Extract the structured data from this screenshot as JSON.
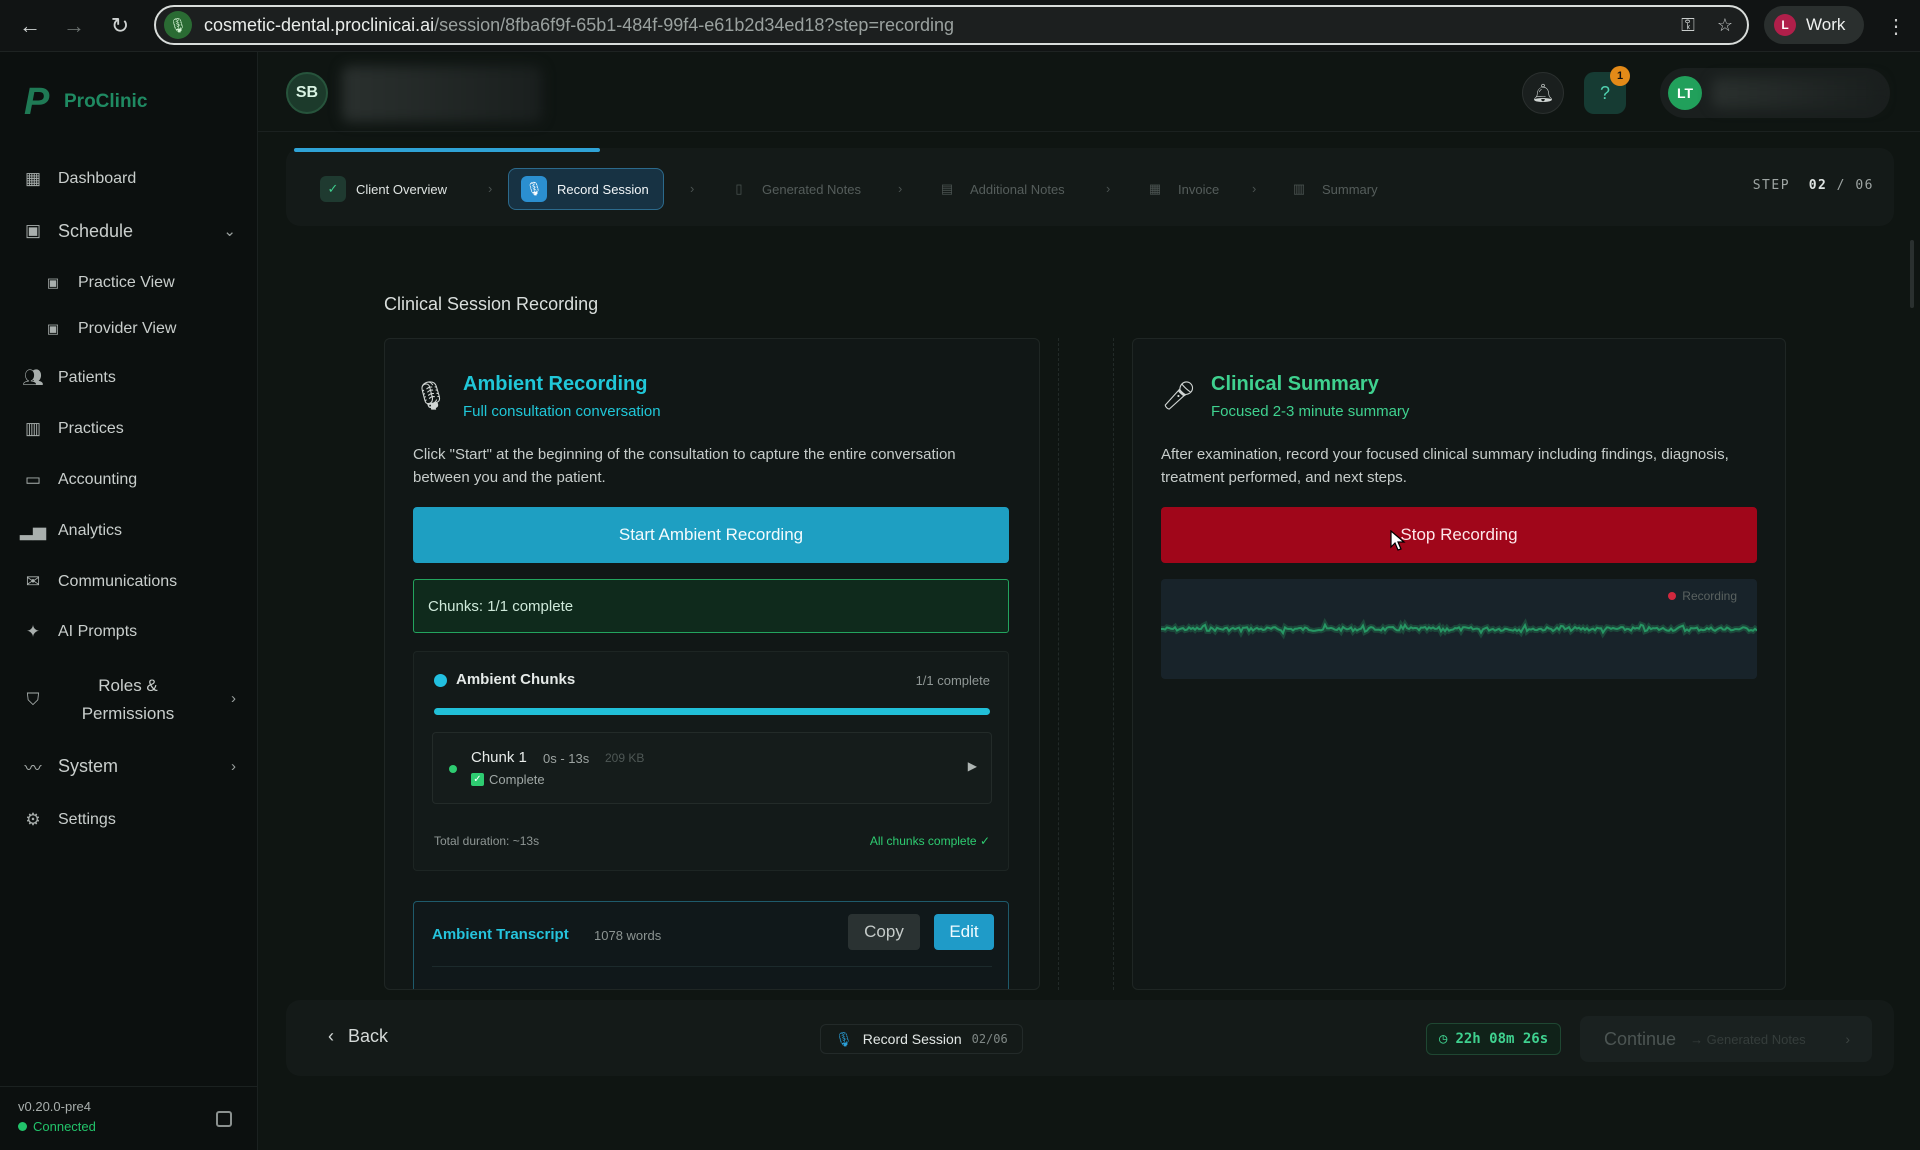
{
  "browser": {
    "url_host": "cosmetic-dental.proclinicai.ai",
    "url_path": "/session/8fba6f9f-65b1-484f-99f4-e61b2d34ed18?step=recording",
    "profile_initial": "L",
    "profile_label": "Work"
  },
  "brand": {
    "name": "ProClinic"
  },
  "sidebar": {
    "items": [
      {
        "label": "Dashboard",
        "icon": "grid-icon"
      },
      {
        "label": "Schedule",
        "icon": "calendar-icon"
      },
      {
        "label": "Practice View",
        "icon": "calendar-icon"
      },
      {
        "label": "Provider View",
        "icon": "calendar-icon"
      },
      {
        "label": "Patients",
        "icon": "users-icon"
      },
      {
        "label": "Practices",
        "icon": "building-icon"
      },
      {
        "label": "Accounting",
        "icon": "card-icon"
      },
      {
        "label": "Analytics",
        "icon": "chart-icon"
      },
      {
        "label": "Communications",
        "icon": "mail-icon"
      },
      {
        "label": "AI Prompts",
        "icon": "sparkle-icon"
      },
      {
        "label": "Roles &",
        "label2": "Permissions",
        "icon": "shield-icon"
      },
      {
        "label": "System",
        "icon": "activity-icon"
      },
      {
        "label": "Settings",
        "icon": "gear-icon"
      }
    ],
    "version": "v0.20.0-pre4",
    "status": "Connected"
  },
  "topbar": {
    "client_initials": "SB",
    "notification_count": "1",
    "user_initials": "LT"
  },
  "stepper": {
    "steps": [
      {
        "label": "Client Overview",
        "state": "done"
      },
      {
        "label": "Record Session",
        "state": "active"
      },
      {
        "label": "Generated Notes",
        "state": "todo"
      },
      {
        "label": "Additional Notes",
        "state": "todo"
      },
      {
        "label": "Invoice",
        "state": "todo"
      },
      {
        "label": "Summary",
        "state": "todo"
      }
    ],
    "step_prefix": "STEP",
    "current": "02",
    "total": "06",
    "progress_fraction": 0.19
  },
  "main": {
    "section_title": "Clinical Session Recording",
    "ambient": {
      "title": "Ambient Recording",
      "subtitle": "Full consultation conversation",
      "description": "Click \"Start\" at the beginning of the consultation to capture the entire conversation between you and the patient.",
      "button": "Start Ambient Recording",
      "chunks_status": "Chunks: 1/1 complete",
      "chunks_card": {
        "title": "Ambient Chunks",
        "count": "1/1 complete",
        "progress_fraction": 1.0,
        "chunk": {
          "name": "Chunk 1",
          "time": "0s - 13s",
          "size": "209 KB",
          "status": "Complete"
        },
        "total": "Total duration: ~13s",
        "all_complete": "All chunks complete ✓"
      },
      "transcript": {
        "title": "Ambient Transcript",
        "words": "1078 words",
        "copy": "Copy",
        "edit": "Edit"
      }
    },
    "clinical": {
      "title": "Clinical Summary",
      "subtitle": "Focused 2-3 minute summary",
      "description": "After examination, record your focused clinical summary including findings, diagnosis, treatment performed, and next steps.",
      "button": "Stop Recording",
      "recording_label": "Recording"
    }
  },
  "footer": {
    "back": "Back",
    "current_step": "Record Session",
    "step_count": "02/06",
    "timer": "22h 08m 26s",
    "continue": "Continue",
    "continue_sub": "→ Generated Notes"
  },
  "colors": {
    "accent_cyan": "#20c7d8",
    "accent_green": "#3fd18f",
    "stop_red": "#a0061a",
    "brand_green": "#1f8a62"
  }
}
